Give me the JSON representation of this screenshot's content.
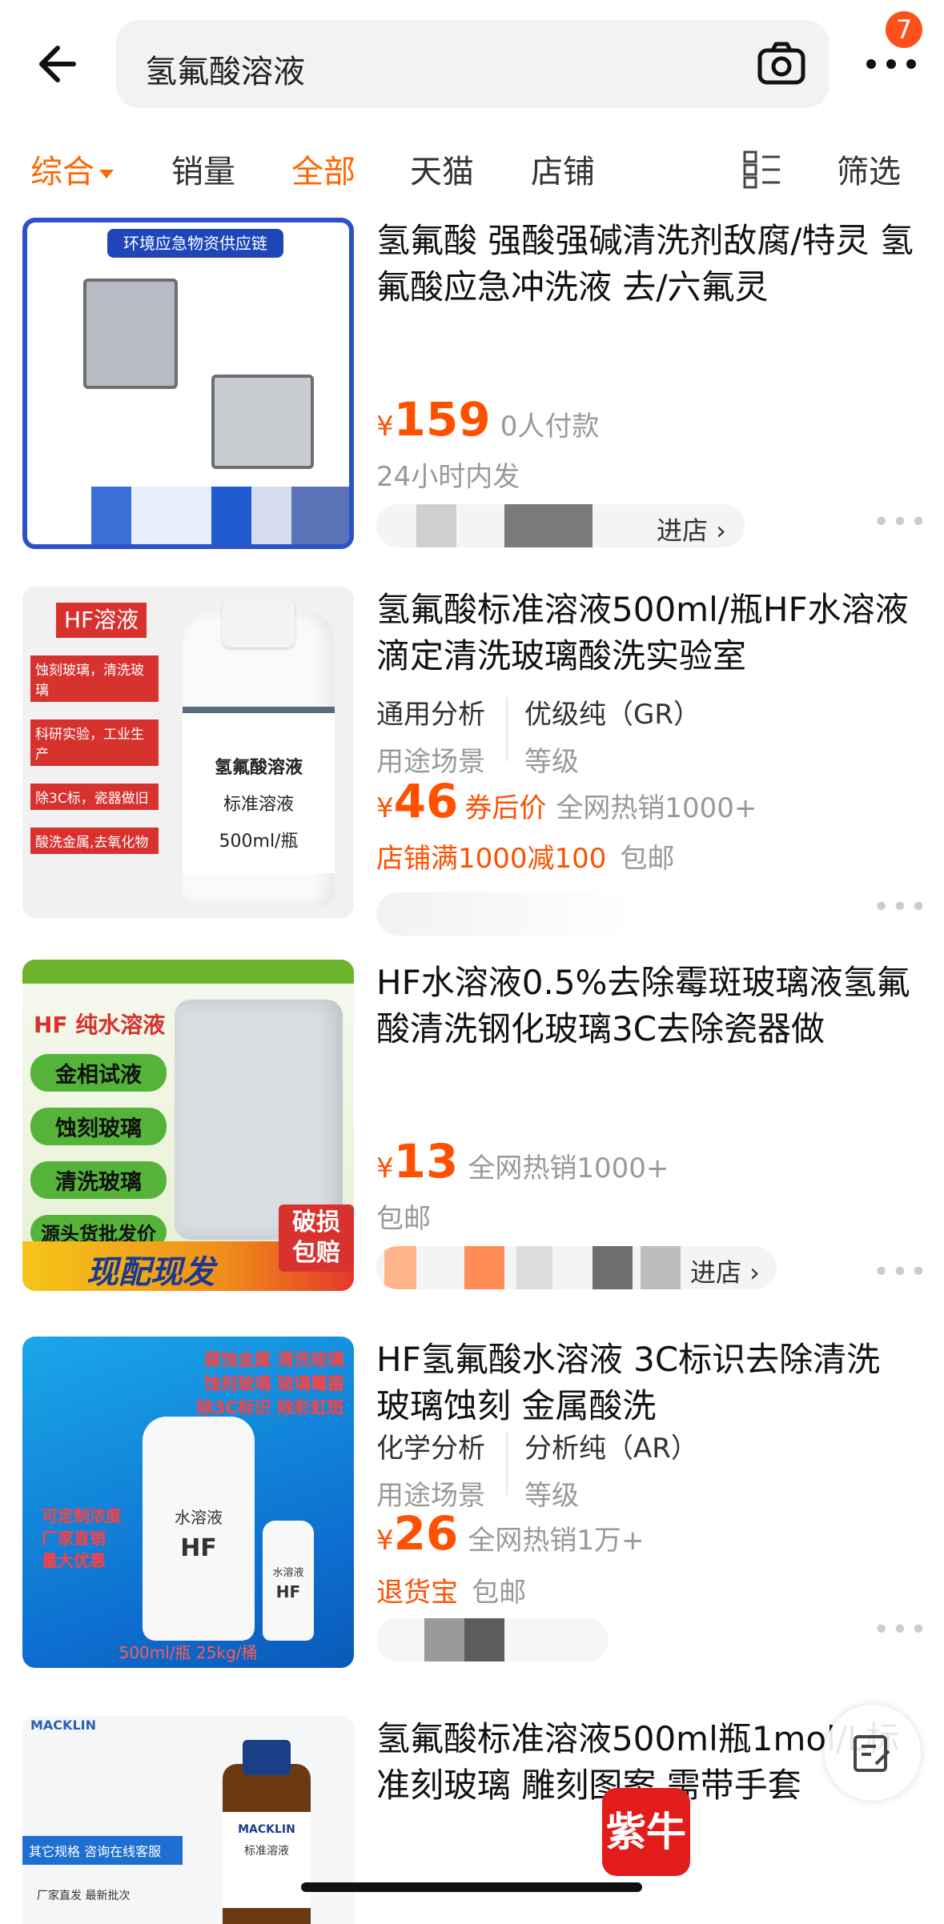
{
  "header": {
    "search_query": "氢氟酸溶液",
    "badge_count": "7"
  },
  "tabs": [
    "综合",
    "销量",
    "全部",
    "天猫",
    "店铺",
    "筛选"
  ],
  "products": [
    {
      "title": "氢氟酸  强酸强碱清洗剂敌腐/特灵 氢氟酸应急冲洗液 去/六氟灵",
      "thumb_text": "环境应急物资供应链",
      "price_yen": "¥",
      "price": "159",
      "sold": "0人付款",
      "line2": "24小时内发",
      "shop_enter": "进店 ›"
    },
    {
      "title": "氢氟酸标准溶液500ml/瓶HF水溶液滴定清洗玻璃酸洗实验室",
      "thumb_tag": "HF溶液",
      "thumb_lines": [
        "蚀刻玻璃，清洗玻璃",
        "科研实验，工业生产",
        "除3C标，瓷器做旧",
        "酸洗金属,去氧化物"
      ],
      "bottle_label": [
        "氢氟酸溶液",
        "标准溶液",
        "500ml/瓶"
      ],
      "attr1_value": "通用分析",
      "attr1_key": "用途场景",
      "attr2_value": "优级纯（GR）",
      "attr2_key": "等级",
      "price_yen": "¥",
      "price": "46",
      "coupon": "券后价",
      "sold": "全网热销1000+",
      "promo": "店铺满1000减100",
      "shipping": "包邮"
    },
    {
      "title": "HF水溶液0.5%去除霉斑玻璃液氢氟酸清洗钢化玻璃3C去除瓷器做",
      "thumb_heading": "HF 纯水溶液",
      "thumb_pills": [
        "金相试液",
        "蚀刻玻璃",
        "清洗玻璃",
        "源头货批发价"
      ],
      "thumb_banner": "现配现发",
      "thumb_corner": [
        "破损",
        "包赔"
      ],
      "price_yen": "¥",
      "price": "13",
      "sold": "全网热销1000+",
      "line2": "包邮",
      "shop_enter": "进店 ›"
    },
    {
      "title": "HF氢氟酸水溶液 3C标识去除清洗 玻璃蚀刻 金属酸洗",
      "thumb_top": [
        "腐蚀金属 清洗玻璃",
        "蚀刻玻璃 玻璃霉菌",
        "除3C标识 除彩虹斑"
      ],
      "thumb_left": [
        "可定制浓度",
        "厂家直销",
        "量大优惠"
      ],
      "thumb_bottom": "500ml/瓶 25kg/桶",
      "bottle_big": [
        "水溶液",
        "HF"
      ],
      "bottle_small": [
        "水溶液",
        "HF"
      ],
      "attr1_value": "化学分析",
      "attr1_key": "用途场景",
      "attr2_value": "分析纯（AR）",
      "attr2_key": "等级",
      "price_yen": "¥",
      "price": "26",
      "sold": "全网热销1万+",
      "promo": "退货宝",
      "shipping": "包邮"
    },
    {
      "title": "氢氟酸标准溶液500ml瓶1mol/L标准刻玻璃 雕刻图案 需带手套",
      "thumb_brand": "MACKLIN",
      "thumb_lines": [
        "其它规格 咨询在线客服",
        "厂家直发 最新批次"
      ],
      "bottle_label": [
        "MACKLIN",
        "标准溶液"
      ]
    }
  ],
  "overlay": {
    "logo_text": "紫牛"
  },
  "colors": {
    "accent": "#ff5000",
    "tab_active": "#ff6600"
  }
}
